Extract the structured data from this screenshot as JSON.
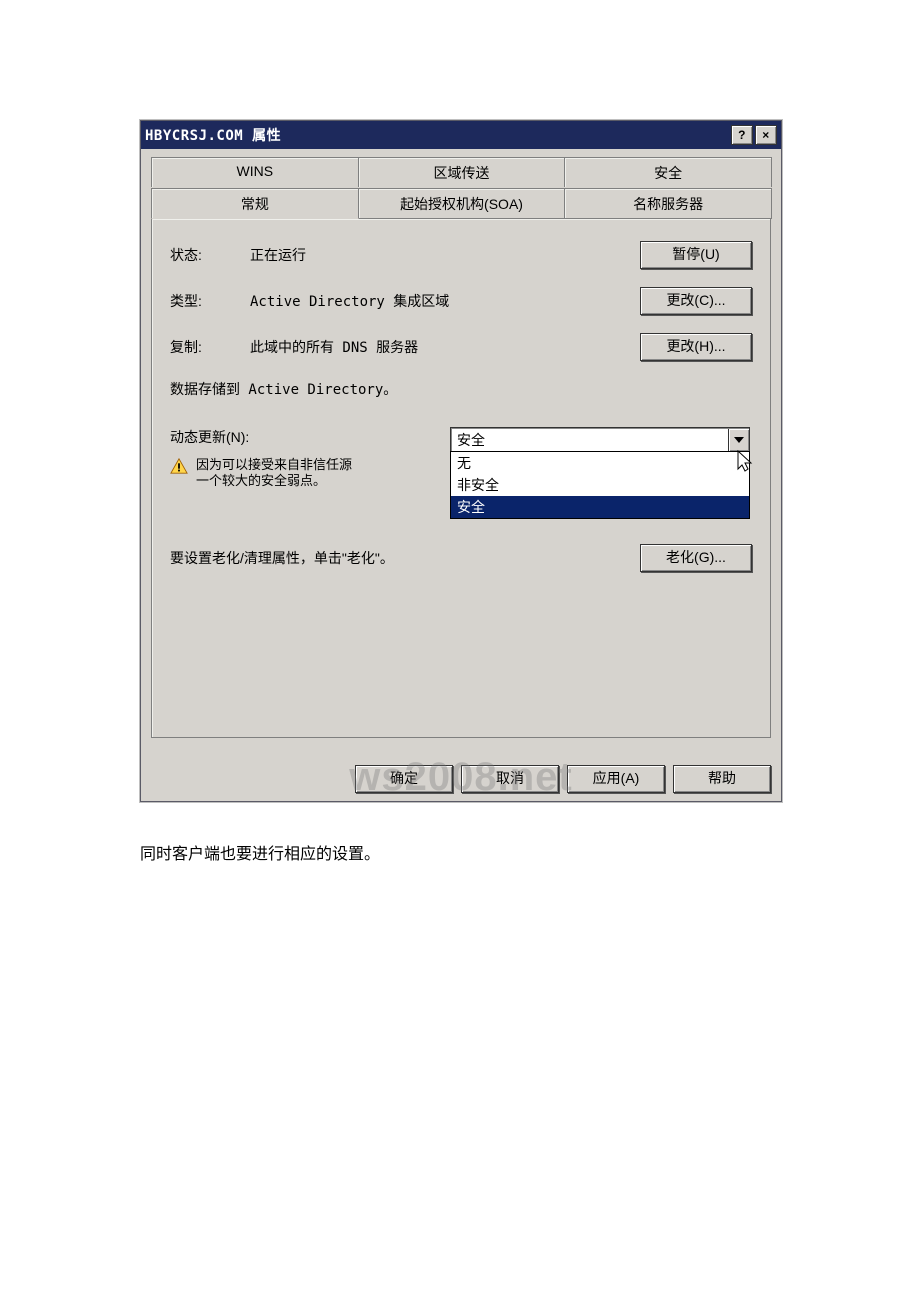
{
  "titlebar": {
    "title": "HBYCRSJ.COM 属性",
    "help_label": "?",
    "close_label": "×"
  },
  "tabs": {
    "row_back": [
      "WINS",
      "区域传送",
      "安全"
    ],
    "row_front": [
      "常规",
      "起始授权机构(SOA)",
      "名称服务器"
    ],
    "selected": "常规"
  },
  "general": {
    "status_label": "状态:",
    "status_value": "正在运行",
    "pause_btn": "暂停(U)",
    "type_label": "类型:",
    "type_value": "Active Directory 集成区域",
    "type_change_btn": "更改(C)...",
    "repl_label": "复制:",
    "repl_value": "此域中的所有 DNS 服务器",
    "repl_change_btn": "更改(H)...",
    "storage_note": "数据存储到 Active Directory。",
    "dyn_label": "动态更新(N):",
    "dyn_selected": "安全",
    "dyn_options": [
      "无",
      "非安全",
      "安全"
    ],
    "warn_text_1": "因为可以接受来自非信任源",
    "warn_text_2": "一个较大的安全弱点。",
    "aging_text": "要设置老化/清理属性，单击\"老化\"。",
    "aging_btn": "老化(G)..."
  },
  "footer": {
    "ok": "确定",
    "cancel": "取消",
    "apply": "应用(A)",
    "help": "帮助"
  },
  "caption": "同时客户端也要进行相应的设置。"
}
